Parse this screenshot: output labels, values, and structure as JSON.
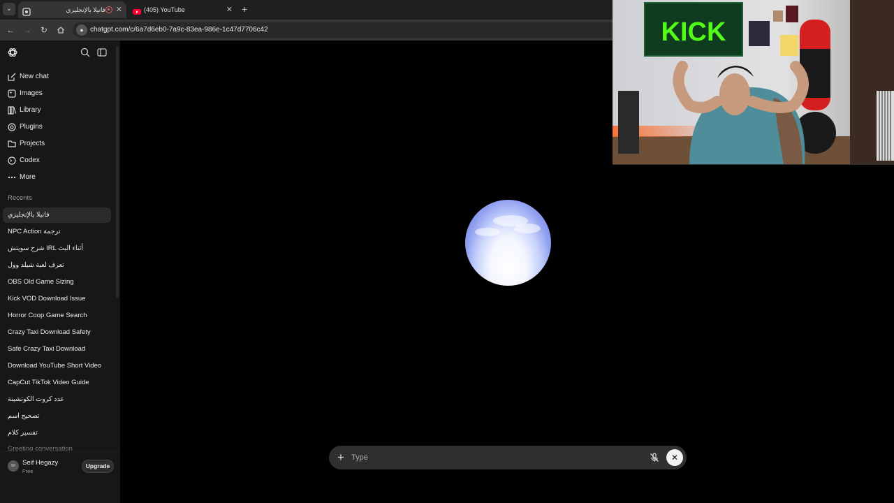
{
  "browser": {
    "tabs": [
      {
        "title": "فانيلا بالإنجليزي",
        "active": true
      },
      {
        "title": "(405) YouTube",
        "active": false
      }
    ],
    "url": "chatgpt.com/c/6a7d6eb0-7a9c-83ea-986e-1c47d7706c42"
  },
  "sidebar": {
    "nav": [
      {
        "label": "New chat",
        "icon": "compose-icon"
      },
      {
        "label": "Images",
        "icon": "images-icon"
      },
      {
        "label": "Library",
        "icon": "library-icon"
      },
      {
        "label": "Plugins",
        "icon": "plugins-icon"
      },
      {
        "label": "Projects",
        "icon": "folder-icon"
      },
      {
        "label": "Codex",
        "icon": "codex-icon"
      },
      {
        "label": "More",
        "icon": "ellipsis-icon"
      }
    ],
    "recents_heading": "Recents",
    "recents": [
      "فانيلا بالإنجليزي",
      "NPC Action ترجمة",
      "شرح سويتش IRL أثناء البث",
      "تعرف لعبة شيلد وول",
      "OBS Old Game Sizing",
      "Kick VOD Download Issue",
      "Horror Coop Game Search",
      "Crazy Taxi Download Safety",
      "Safe Crazy Taxi Download",
      "Download YouTube Short Video",
      "CapCut TikTok Video Guide",
      "عدد كروت الكوتشينة",
      "تصحيح اسم",
      "تفسير كلام",
      "Greeting conversation"
    ],
    "user": {
      "name": "Seif Hegazy",
      "plan": "Free",
      "initials": "SF"
    },
    "upgrade_label": "Upgrade"
  },
  "composer": {
    "placeholder": "Type"
  },
  "webcam": {
    "banner_text": "KICK"
  },
  "colors": {
    "orb_core": "#ffffff",
    "orb_edge": "#6b7ce8",
    "sidebar_bg": "#171717",
    "app_bg": "#000000",
    "kick_green": "#53fc18"
  }
}
